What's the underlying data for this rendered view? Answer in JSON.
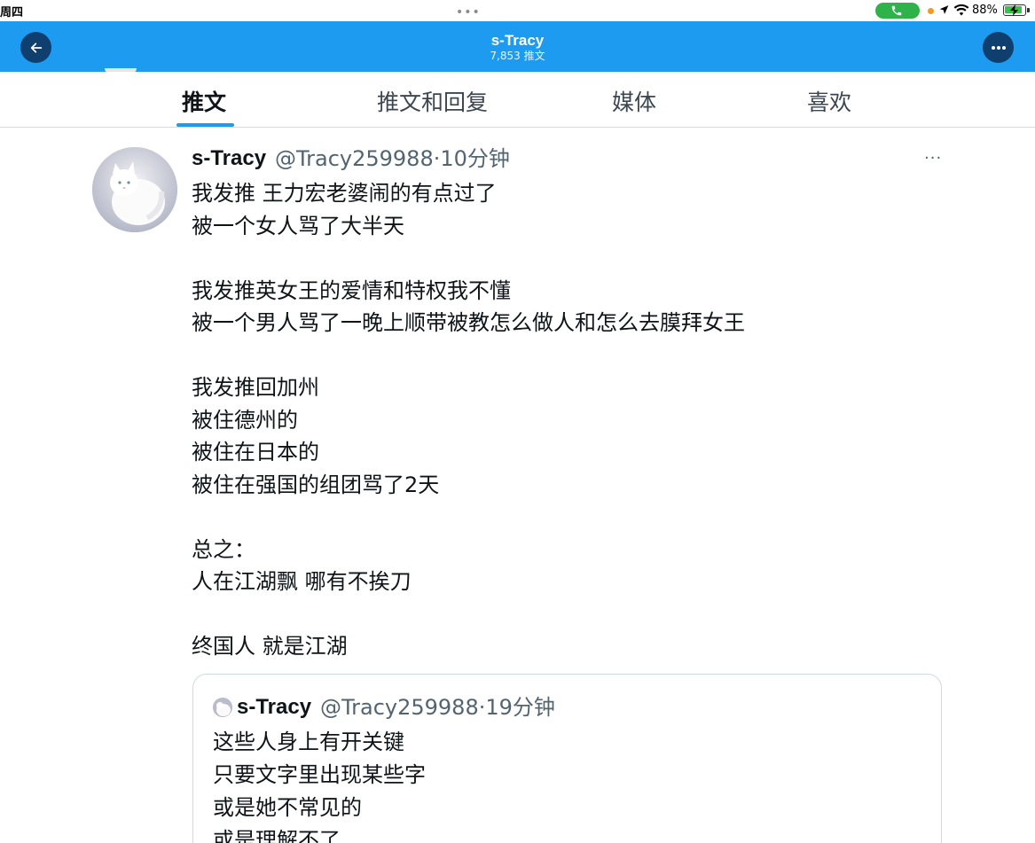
{
  "status_bar": {
    "day": "周四",
    "dots": "•••",
    "battery": "88%",
    "call_color": "#2eb34a"
  },
  "header": {
    "title": "s-Tracy",
    "subtitle": "7,853 推文",
    "back_icon": "arrow-left-icon",
    "more_icon": "more-horizontal-icon",
    "bg_color": "#1d9bf0"
  },
  "tabs": [
    {
      "label": "推文",
      "active": true
    },
    {
      "label": "推文和回复",
      "active": false
    },
    {
      "label": "媒体",
      "active": false
    },
    {
      "label": "喜欢",
      "active": false
    }
  ],
  "tweet": {
    "name": "s-Tracy",
    "handle_time": "@Tracy259988·10分钟",
    "more": "···",
    "lines": [
      "我发推 王力宏老婆闹的有点过了",
      "被一个女人骂了大半天",
      "",
      "我发推英女王的爱情和特权我不懂",
      "被一个男人骂了一晚上顺带被教怎么做人和怎么去膜拜女王",
      "",
      "我发推回加州",
      "被住德州的",
      "被住在日本的",
      "被住在强国的组团骂了2天",
      "",
      "总之：",
      "人在江湖飘 哪有不挨刀",
      "",
      "终国人 就是江湖"
    ]
  },
  "quote": {
    "name": "s-Tracy",
    "handle_time": "@Tracy259988·19分钟",
    "lines": [
      "这些人身上有开关键",
      "只要文字里出现某些字",
      "或是她不常见的",
      "或是理解不了"
    ]
  }
}
